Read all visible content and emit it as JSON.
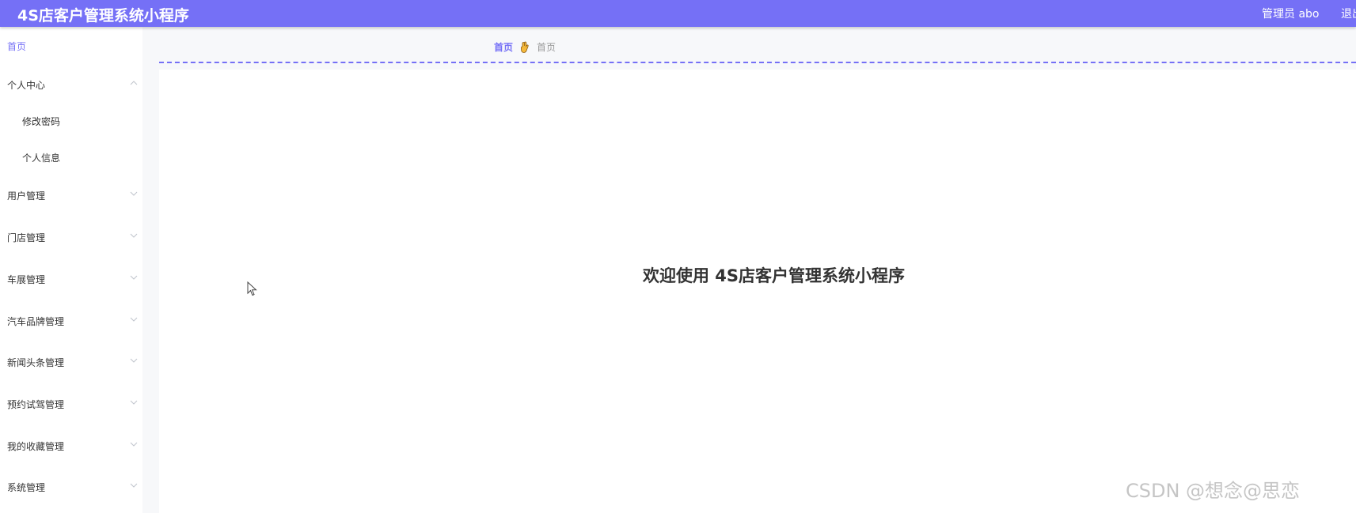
{
  "header": {
    "title": "4S店客户管理系统小程序",
    "user": "管理员 abo",
    "logout": "退出"
  },
  "sidebar": {
    "items": [
      {
        "label": "首页",
        "active": true
      },
      {
        "label": "个人中心",
        "expanded": true,
        "icon": "chevron-up-icon"
      },
      {
        "label": "修改密码",
        "sub": true
      },
      {
        "label": "个人信息",
        "sub": true
      },
      {
        "label": "用户管理",
        "icon": "chevron-down-icon"
      },
      {
        "label": "门店管理",
        "icon": "chevron-down-icon"
      },
      {
        "label": "车展管理",
        "icon": "chevron-down-icon"
      },
      {
        "label": "汽车品牌管理",
        "icon": "chevron-down-icon"
      },
      {
        "label": "新闻头条管理",
        "icon": "chevron-down-icon"
      },
      {
        "label": "预约试驾管理",
        "icon": "chevron-down-icon"
      },
      {
        "label": "我的收藏管理",
        "icon": "chevron-down-icon"
      },
      {
        "label": "系统管理",
        "icon": "chevron-down-icon"
      }
    ]
  },
  "breadcrumb": {
    "home": "首页",
    "current": "首页",
    "separator_icon": "hand-icon"
  },
  "main": {
    "welcome": "欢迎使用 4S店客户管理系统小程序"
  },
  "watermark": "CSDN @想念@思恋",
  "colors": {
    "accent": "#7570f6",
    "text": "#333333",
    "muted": "#999999"
  }
}
